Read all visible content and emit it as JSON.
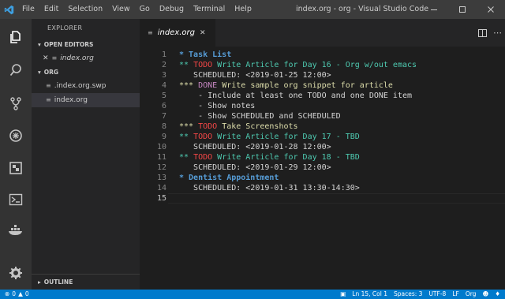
{
  "titlebar": {
    "menu": [
      "File",
      "Edit",
      "Selection",
      "View",
      "Go",
      "Debug",
      "Terminal",
      "Help"
    ],
    "title": "index.org - org - Visual Studio Code"
  },
  "sidebar": {
    "title": "EXPLORER",
    "open_editors_label": "OPEN EDITORS",
    "open_editor_file": "index.org",
    "folder_label": "ORG",
    "files": [
      ".index.org.swp",
      "index.org"
    ],
    "outline_label": "OUTLINE"
  },
  "tab": {
    "name": "index.org"
  },
  "editor": {
    "lines": [
      {
        "n": "1",
        "parts": [
          [
            "c-blue-b",
            "* Task List"
          ]
        ]
      },
      {
        "n": "2",
        "parts": [
          [
            "c-teal",
            "** "
          ],
          [
            "c-red",
            "TODO"
          ],
          [
            "c-teal",
            " Write Article for Day 16 - Org w/out emacs"
          ]
        ]
      },
      {
        "n": "3",
        "parts": [
          [
            "c-text",
            "   SCHEDULED: <2019-01-25 12:00>"
          ]
        ]
      },
      {
        "n": "4",
        "parts": [
          [
            "c-yellow",
            "*** "
          ],
          [
            "c-purple",
            "DONE"
          ],
          [
            "c-yellow",
            " Write sample org snippet for article"
          ]
        ]
      },
      {
        "n": "5",
        "parts": [
          [
            "c-text",
            "    - Include at least one TODO and one DONE item"
          ]
        ]
      },
      {
        "n": "6",
        "parts": [
          [
            "c-text",
            "    - Show notes"
          ]
        ]
      },
      {
        "n": "7",
        "parts": [
          [
            "c-text",
            "    - Show SCHEDULED and SCHEDULED"
          ]
        ]
      },
      {
        "n": "8",
        "parts": [
          [
            "c-yellow",
            "*** "
          ],
          [
            "c-red",
            "TODO"
          ],
          [
            "c-yellow",
            " Take Screenshots"
          ]
        ]
      },
      {
        "n": "9",
        "parts": [
          [
            "c-teal",
            "** "
          ],
          [
            "c-red",
            "TODO"
          ],
          [
            "c-teal",
            " Write Article for Day 17 - TBD"
          ]
        ]
      },
      {
        "n": "10",
        "parts": [
          [
            "c-text",
            "   SCHEDULED: <2019-01-28 12:00>"
          ]
        ]
      },
      {
        "n": "11",
        "parts": [
          [
            "c-teal",
            "** "
          ],
          [
            "c-red",
            "TODO"
          ],
          [
            "c-teal",
            " Write Article for Day 18 - TBD"
          ]
        ]
      },
      {
        "n": "12",
        "parts": [
          [
            "c-text",
            "   SCHEDULED: <2019-01-29 12:00>"
          ]
        ]
      },
      {
        "n": "13",
        "parts": [
          [
            "c-blue-b",
            "* Dentist Appointment"
          ]
        ]
      },
      {
        "n": "14",
        "parts": [
          [
            "c-text",
            "   SCHEDULED: <2019-01-31 13:30-14:30>"
          ]
        ]
      },
      {
        "n": "15",
        "parts": []
      }
    ],
    "active_line": "15"
  },
  "statusbar": {
    "errors": "0",
    "warnings": "0",
    "position": "Ln 15, Col 1",
    "spaces": "Spaces: 3",
    "encoding": "UTF-8",
    "eol": "LF",
    "language": "Org"
  },
  "colors": {
    "accent": "#007acc",
    "activity_bar": "#333333",
    "sidebar": "#252526",
    "editor": "#1e1e1e"
  }
}
